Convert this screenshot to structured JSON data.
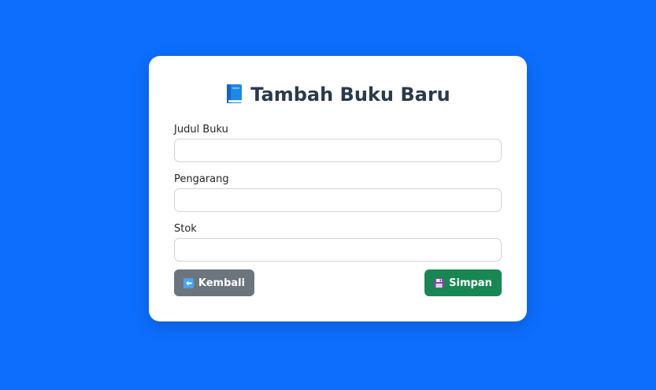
{
  "page": {
    "title": "Tambah Buku Baru",
    "title_icon": "book-icon",
    "background_color": "#0d6efd"
  },
  "form": {
    "fields": [
      {
        "label": "Judul Buku",
        "value": "",
        "placeholder": ""
      },
      {
        "label": "Pengarang",
        "value": "",
        "placeholder": ""
      },
      {
        "label": "Stok",
        "value": "",
        "placeholder": ""
      }
    ]
  },
  "actions": {
    "back": {
      "label": "Kembali",
      "icon": "arrow-left-icon",
      "color": "#6c757d"
    },
    "save": {
      "label": "Simpan",
      "icon": "floppy-disk-icon",
      "color": "#198754"
    }
  }
}
